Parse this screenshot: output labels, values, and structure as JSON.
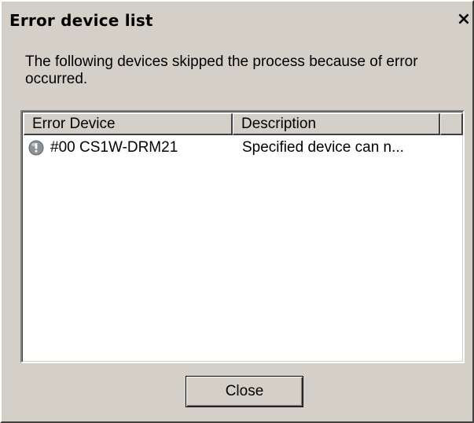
{
  "window": {
    "title": "Error device list",
    "close_glyph": "×"
  },
  "message": "The following devices skipped the process because of error occurred.",
  "list": {
    "columns": [
      "Error Device",
      "Description",
      ""
    ],
    "rows": [
      {
        "icon": "error-device-icon",
        "device": "#00 CS1W-DRM21",
        "description": "Specified device can n..."
      }
    ]
  },
  "buttons": {
    "close_label": "Close"
  },
  "colors": {
    "dialog_face": "#d4d0c8",
    "list_background": "#ffffff",
    "icon_fill": "#8c9296"
  }
}
